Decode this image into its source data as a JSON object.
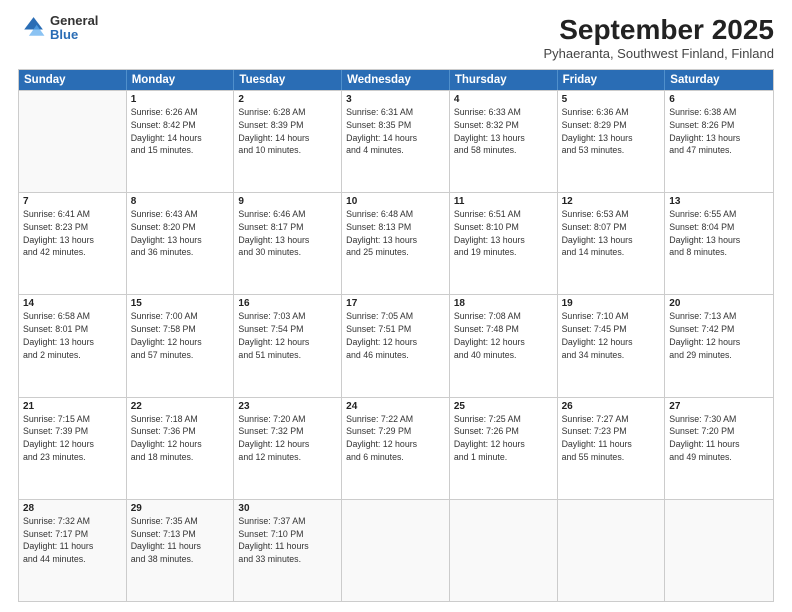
{
  "header": {
    "logo_general": "General",
    "logo_blue": "Blue",
    "main_title": "September 2025",
    "subtitle": "Pyhaeranta, Southwest Finland, Finland"
  },
  "days_of_week": [
    "Sunday",
    "Monday",
    "Tuesday",
    "Wednesday",
    "Thursday",
    "Friday",
    "Saturday"
  ],
  "weeks": [
    [
      {
        "day": "",
        "info": ""
      },
      {
        "day": "1",
        "info": "Sunrise: 6:26 AM\nSunset: 8:42 PM\nDaylight: 14 hours\nand 15 minutes."
      },
      {
        "day": "2",
        "info": "Sunrise: 6:28 AM\nSunset: 8:39 PM\nDaylight: 14 hours\nand 10 minutes."
      },
      {
        "day": "3",
        "info": "Sunrise: 6:31 AM\nSunset: 8:35 PM\nDaylight: 14 hours\nand 4 minutes."
      },
      {
        "day": "4",
        "info": "Sunrise: 6:33 AM\nSunset: 8:32 PM\nDaylight: 13 hours\nand 58 minutes."
      },
      {
        "day": "5",
        "info": "Sunrise: 6:36 AM\nSunset: 8:29 PM\nDaylight: 13 hours\nand 53 minutes."
      },
      {
        "day": "6",
        "info": "Sunrise: 6:38 AM\nSunset: 8:26 PM\nDaylight: 13 hours\nand 47 minutes."
      }
    ],
    [
      {
        "day": "7",
        "info": "Sunrise: 6:41 AM\nSunset: 8:23 PM\nDaylight: 13 hours\nand 42 minutes."
      },
      {
        "day": "8",
        "info": "Sunrise: 6:43 AM\nSunset: 8:20 PM\nDaylight: 13 hours\nand 36 minutes."
      },
      {
        "day": "9",
        "info": "Sunrise: 6:46 AM\nSunset: 8:17 PM\nDaylight: 13 hours\nand 30 minutes."
      },
      {
        "day": "10",
        "info": "Sunrise: 6:48 AM\nSunset: 8:13 PM\nDaylight: 13 hours\nand 25 minutes."
      },
      {
        "day": "11",
        "info": "Sunrise: 6:51 AM\nSunset: 8:10 PM\nDaylight: 13 hours\nand 19 minutes."
      },
      {
        "day": "12",
        "info": "Sunrise: 6:53 AM\nSunset: 8:07 PM\nDaylight: 13 hours\nand 14 minutes."
      },
      {
        "day": "13",
        "info": "Sunrise: 6:55 AM\nSunset: 8:04 PM\nDaylight: 13 hours\nand 8 minutes."
      }
    ],
    [
      {
        "day": "14",
        "info": "Sunrise: 6:58 AM\nSunset: 8:01 PM\nDaylight: 13 hours\nand 2 minutes."
      },
      {
        "day": "15",
        "info": "Sunrise: 7:00 AM\nSunset: 7:58 PM\nDaylight: 12 hours\nand 57 minutes."
      },
      {
        "day": "16",
        "info": "Sunrise: 7:03 AM\nSunset: 7:54 PM\nDaylight: 12 hours\nand 51 minutes."
      },
      {
        "day": "17",
        "info": "Sunrise: 7:05 AM\nSunset: 7:51 PM\nDaylight: 12 hours\nand 46 minutes."
      },
      {
        "day": "18",
        "info": "Sunrise: 7:08 AM\nSunset: 7:48 PM\nDaylight: 12 hours\nand 40 minutes."
      },
      {
        "day": "19",
        "info": "Sunrise: 7:10 AM\nSunset: 7:45 PM\nDaylight: 12 hours\nand 34 minutes."
      },
      {
        "day": "20",
        "info": "Sunrise: 7:13 AM\nSunset: 7:42 PM\nDaylight: 12 hours\nand 29 minutes."
      }
    ],
    [
      {
        "day": "21",
        "info": "Sunrise: 7:15 AM\nSunset: 7:39 PM\nDaylight: 12 hours\nand 23 minutes."
      },
      {
        "day": "22",
        "info": "Sunrise: 7:18 AM\nSunset: 7:36 PM\nDaylight: 12 hours\nand 18 minutes."
      },
      {
        "day": "23",
        "info": "Sunrise: 7:20 AM\nSunset: 7:32 PM\nDaylight: 12 hours\nand 12 minutes."
      },
      {
        "day": "24",
        "info": "Sunrise: 7:22 AM\nSunset: 7:29 PM\nDaylight: 12 hours\nand 6 minutes."
      },
      {
        "day": "25",
        "info": "Sunrise: 7:25 AM\nSunset: 7:26 PM\nDaylight: 12 hours\nand 1 minute."
      },
      {
        "day": "26",
        "info": "Sunrise: 7:27 AM\nSunset: 7:23 PM\nDaylight: 11 hours\nand 55 minutes."
      },
      {
        "day": "27",
        "info": "Sunrise: 7:30 AM\nSunset: 7:20 PM\nDaylight: 11 hours\nand 49 minutes."
      }
    ],
    [
      {
        "day": "28",
        "info": "Sunrise: 7:32 AM\nSunset: 7:17 PM\nDaylight: 11 hours\nand 44 minutes."
      },
      {
        "day": "29",
        "info": "Sunrise: 7:35 AM\nSunset: 7:13 PM\nDaylight: 11 hours\nand 38 minutes."
      },
      {
        "day": "30",
        "info": "Sunrise: 7:37 AM\nSunset: 7:10 PM\nDaylight: 11 hours\nand 33 minutes."
      },
      {
        "day": "",
        "info": ""
      },
      {
        "day": "",
        "info": ""
      },
      {
        "day": "",
        "info": ""
      },
      {
        "day": "",
        "info": ""
      }
    ]
  ]
}
